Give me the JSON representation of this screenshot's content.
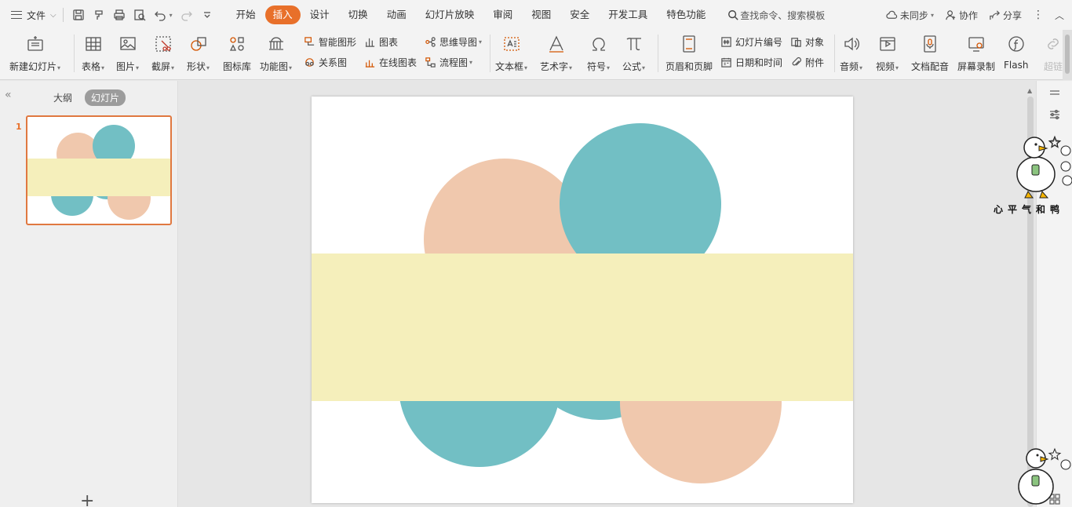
{
  "menubar": {
    "file_label": "文件",
    "tabs": [
      {
        "label": "开始"
      },
      {
        "label": "插入",
        "active": true
      },
      {
        "label": "设计"
      },
      {
        "label": "切换"
      },
      {
        "label": "动画"
      },
      {
        "label": "幻灯片放映"
      },
      {
        "label": "审阅"
      },
      {
        "label": "视图"
      },
      {
        "label": "安全"
      },
      {
        "label": "开发工具"
      },
      {
        "label": "特色功能"
      }
    ],
    "search_label": "查找命令、搜索模板",
    "sync_label": "未同步",
    "collab_label": "协作",
    "share_label": "分享"
  },
  "ribbon": {
    "new_slide": "新建幻灯片",
    "table": "表格",
    "picture": "图片",
    "screenshot": "截屏",
    "shape": "形状",
    "icon_lib": "图标库",
    "func_chart": "功能图",
    "smart_art": "智能图形",
    "chart": "图表",
    "relation": "关系图",
    "online_chart": "在线图表",
    "mind_map": "思维导图",
    "flow_chart": "流程图",
    "textbox": "文本框",
    "wordart": "艺术字",
    "symbol": "符号",
    "formula": "公式",
    "header_footer": "页眉和页脚",
    "slide_number": "幻灯片编号",
    "object": "对象",
    "date_time": "日期和时间",
    "attachment": "附件",
    "audio": "音频",
    "video": "视频",
    "doc_dub": "文档配音",
    "screen_record": "屏幕录制",
    "flash": "Flash",
    "hyperlink": "超链"
  },
  "leftpanel": {
    "tab_outline": "大纲",
    "tab_slides": "幻灯片",
    "slide_number": "1",
    "add_symbol": "+"
  },
  "slide": {
    "colors": {
      "peach": "#f0c8ad",
      "teal": "#72bfc4",
      "yellow": "#f5efbb"
    }
  },
  "sticker": {
    "caption": "心平气和鸭"
  }
}
